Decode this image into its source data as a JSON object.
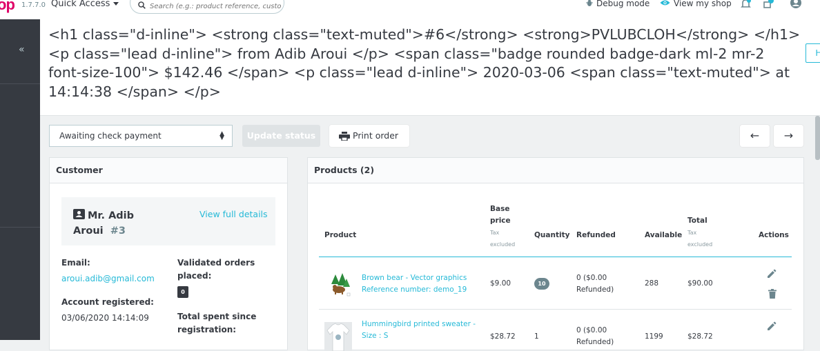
{
  "topbar": {
    "logo": "op",
    "version": "1.7.7.0",
    "quick_access": "Quick Access",
    "search_placeholder": "Search (e.g.: product reference, custom",
    "debug_mode": "Debug mode",
    "view_my_shop": "View my shop"
  },
  "sidebar": {
    "collapse": "«"
  },
  "header": {
    "title": "<h1 class=\"d-inline\"> <strong class=\"text-muted\">#6</strong> <strong>PVLUBCLOH</strong> </h1> <p class=\"lead d-inline\"> from Adib Aroui </p> <span class=\"badge rounded badge-dark ml-2 mr-2 font-size-100\"> $142.46 </span> <p class=\"lead d-inline\"> 2020-03-06 <span class=\"text-muted\"> at 14:14:38 </span> </p>",
    "help": "Help"
  },
  "actions": {
    "status_selected": "Awaiting check payment",
    "update_status": "Update status",
    "print_order": "Print order",
    "prev": "←",
    "next": "→"
  },
  "customer": {
    "heading": "Customer",
    "name_first": "Mr. Adib",
    "name_last": "Aroui",
    "id": "#3",
    "view_full_details": "View full details",
    "email_label": "Email:",
    "email": "aroui.adib@gmail.com",
    "account_registered_label": "Account registered:",
    "account_registered": "03/06/2020 14:14:09",
    "validated_orders_label_1": "Validated orders",
    "validated_orders_label_2": "placed:",
    "validated_orders": "0",
    "total_spent_label_1": "Total spent since",
    "total_spent_label_2": "registration:"
  },
  "products": {
    "heading": "Products (2)",
    "columns": {
      "product": "Product",
      "base_price_1": "Base",
      "base_price_2": "price",
      "base_price_sub_1": "Tax",
      "base_price_sub_2": "excluded",
      "quantity": "Quantity",
      "refunded": "Refunded",
      "available": "Available",
      "total": "Total",
      "total_sub_1": "Tax",
      "total_sub_2": "excluded",
      "actions": "Actions"
    },
    "rows": [
      {
        "name": "Brown bear - Vector graphics",
        "reference": "Reference number: demo_19",
        "base_price": "$9.00",
        "quantity": "10",
        "refunded_1": "0 ($0.00",
        "refunded_2": "Refunded)",
        "available": "288",
        "total": "$90.00"
      },
      {
        "name": "Hummingbird printed sweater -",
        "reference": "Size : S",
        "base_price": "$28.72",
        "quantity": "1",
        "refunded_1": "0 ($0.00",
        "refunded_2": "Refunded)",
        "available": "1199",
        "total": "$28.72"
      }
    ]
  },
  "colors": {
    "accent": "#25b9d7",
    "sidebar": "#363a41",
    "logo": "#df0067"
  }
}
